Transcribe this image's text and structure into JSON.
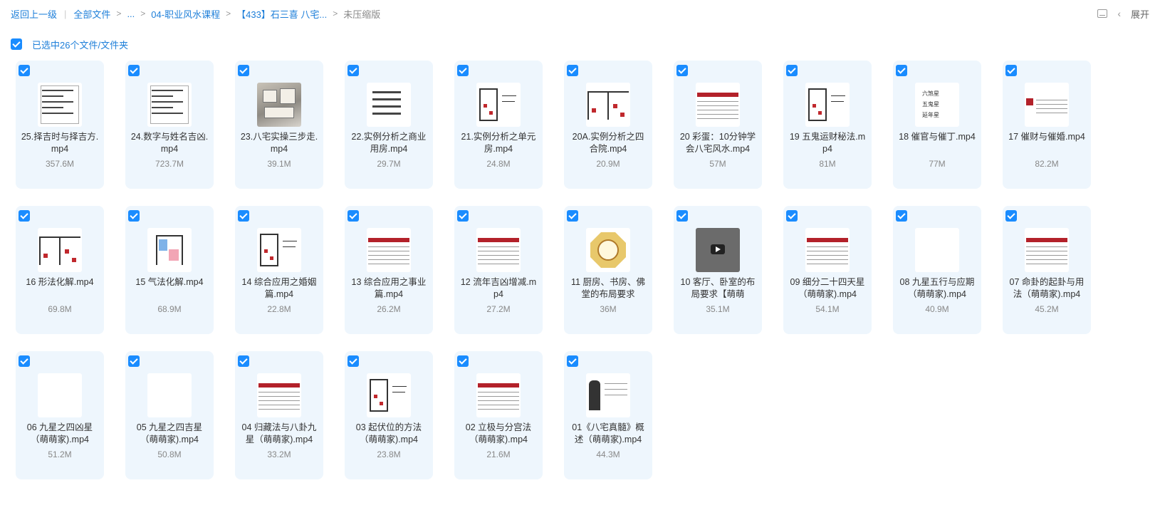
{
  "breadcrumb": {
    "back": "返回上一级",
    "items": [
      "全部文件",
      "...",
      "04-职业风水课程",
      "【433】石三喜 八宅...",
      "未压缩版"
    ]
  },
  "toolbar": {
    "expand_label": "展开"
  },
  "selection": {
    "label": "已选中26个文件/文件夹",
    "checked": true
  },
  "files": [
    {
      "name": "25.择吉时与择吉方.mp4",
      "size": "357.6M",
      "thumb": "doc",
      "checked": true
    },
    {
      "name": "24.数字与姓名吉凶.mp4",
      "size": "723.7M",
      "thumb": "doc",
      "checked": true
    },
    {
      "name": "23.八宅实操三步走.mp4",
      "size": "39.1M",
      "thumb": "house",
      "checked": true
    },
    {
      "name": "22.实例分析之商业用房.mp4",
      "size": "29.7M",
      "thumb": "list",
      "checked": true
    },
    {
      "name": "21.实例分析之单元房.mp4",
      "size": "24.8M",
      "thumb": "plan",
      "checked": true
    },
    {
      "name": "20A.实例分析之四合院.mp4",
      "size": "20.9M",
      "thumb": "plan2",
      "checked": true
    },
    {
      "name": "20 彩蛋：10分钟学会八宅风水.mp4",
      "size": "57M",
      "thumb": "table",
      "checked": true
    },
    {
      "name": "19 五鬼运财秘法.mp4",
      "size": "81M",
      "thumb": "plan",
      "checked": true
    },
    {
      "name": "18 催官与催丁.mp4",
      "size": "77M",
      "thumb": "text",
      "checked": true
    },
    {
      "name": "17 催财与催婚.mp4",
      "size": "82.2M",
      "thumb": "redside",
      "checked": true
    },
    {
      "name": "16 形法化解.mp4",
      "size": "69.8M",
      "thumb": "plan2",
      "checked": true
    },
    {
      "name": "15 气法化解.mp4",
      "size": "68.9M",
      "thumb": "colorplan",
      "checked": true
    },
    {
      "name": "14 综合应用之婚姻篇.mp4",
      "size": "22.8M",
      "thumb": "plan",
      "checked": true
    },
    {
      "name": "13 综合应用之事业篇.mp4",
      "size": "26.2M",
      "thumb": "table",
      "checked": true
    },
    {
      "name": "12 流年吉凶增减.mp4",
      "size": "27.2M",
      "thumb": "table",
      "checked": true
    },
    {
      "name": "11 厨房、书房、佛堂的布局要求",
      "size": "36M",
      "thumb": "bagua",
      "checked": true
    },
    {
      "name": "10 客厅、卧室的布局要求【萌萌",
      "size": "35.1M",
      "thumb": "video",
      "checked": true
    },
    {
      "name": "09 细分二十四天星（萌萌家).mp4",
      "size": "54.1M",
      "thumb": "table",
      "checked": true
    },
    {
      "name": "08 九星五行与应期（萌萌家).mp4",
      "size": "40.9M",
      "thumb": "yellow",
      "checked": true
    },
    {
      "name": "07 命卦的起卦与用法（萌萌家).mp4",
      "size": "45.2M",
      "thumb": "table",
      "checked": true
    },
    {
      "name": "06 九星之四凶星（萌萌家).mp4",
      "size": "51.2M",
      "thumb": "yellow",
      "checked": true
    },
    {
      "name": "05 九星之四吉星（萌萌家).mp4",
      "size": "50.8M",
      "thumb": "yellow",
      "checked": true
    },
    {
      "name": "04 归藏法与八卦九星（萌萌家).mp4",
      "size": "33.2M",
      "thumb": "table",
      "checked": true
    },
    {
      "name": "03 起伏位的方法（萌萌家).mp4",
      "size": "23.8M",
      "thumb": "plan",
      "checked": true
    },
    {
      "name": "02 立极与分宫法（萌萌家).mp4",
      "size": "21.6M",
      "thumb": "table",
      "checked": true
    },
    {
      "name": "01《八宅真髓》概述（萌萌家).mp4",
      "size": "44.3M",
      "thumb": "person",
      "checked": true
    }
  ],
  "thumb_text": [
    "六煞星",
    "五鬼星",
    "延年星"
  ],
  "colors": {
    "accent": "#1a8cff",
    "card_bg": "#eef6fd",
    "link": "#1e7fd9"
  }
}
